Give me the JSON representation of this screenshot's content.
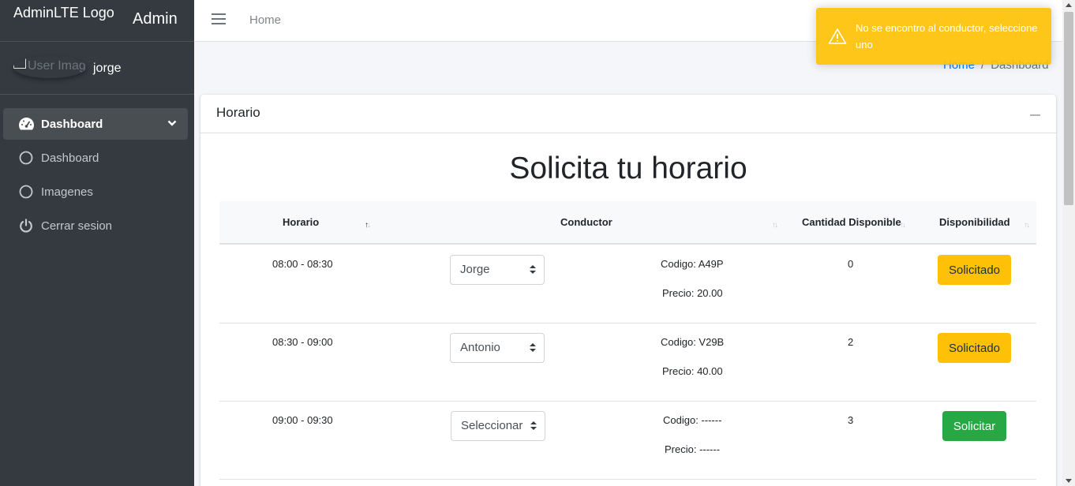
{
  "sidebar": {
    "logo_alt": "AdminLTE Logo",
    "brand": "Admin",
    "user_image_alt": "User Image",
    "user_name": "jorge",
    "menu": [
      {
        "label": "Dashboard",
        "icon": "tachometer-icon",
        "active": true
      },
      {
        "label": "Dashboard",
        "icon": "circle-icon"
      },
      {
        "label": "Imagenes",
        "icon": "circle-icon"
      },
      {
        "label": "Cerrar sesion",
        "icon": "power-icon"
      }
    ]
  },
  "header": {
    "home_link": "Home"
  },
  "breadcrumb": {
    "home": "Home",
    "separator": "/",
    "current": "Dashboard"
  },
  "card": {
    "title": "Horario",
    "heading": "Solicita tu horario"
  },
  "table": {
    "headers": [
      "Horario",
      "Conductor",
      "Cantidad Disponible",
      "Disponibilidad"
    ],
    "rows": [
      {
        "horario": "08:00 - 08:30",
        "conductor": "Jorge",
        "codigo": "Codigo: A49P",
        "precio": "Precio: 20.00",
        "cantidad": "0",
        "action": "Solicitado",
        "action_type": "warning"
      },
      {
        "horario": "08:30 - 09:00",
        "conductor": "Antonio",
        "codigo": "Codigo: V29B",
        "precio": "Precio: 40.00",
        "cantidad": "2",
        "action": "Solicitado",
        "action_type": "warning"
      },
      {
        "horario": "09:00 - 09:30",
        "conductor": "Seleccionar",
        "codigo": "Codigo: ------",
        "precio": "Precio: ------",
        "cantidad": "3",
        "action": "Solicitar",
        "action_type": "success"
      }
    ]
  },
  "toast": {
    "message": "No se encontro al conductor, seleccione uno",
    "icon": "warning-icon"
  },
  "colors": {
    "sidebar_bg": "#343a40",
    "warning": "#ffc107",
    "success": "#28a745",
    "link": "#007bff"
  }
}
